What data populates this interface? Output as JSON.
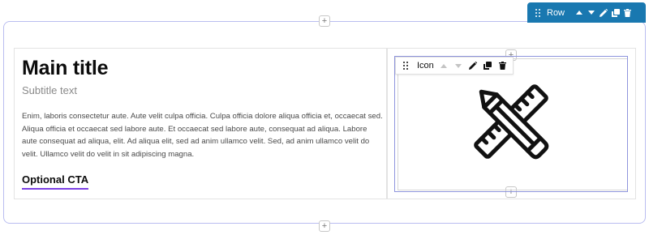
{
  "row_toolbar": {
    "label": "Row",
    "drag_icon": "drag-handle-icon",
    "move_up_icon": "caret-up-icon",
    "move_down_icon": "caret-down-icon",
    "edit_icon": "pencil-icon",
    "duplicate_icon": "duplicate-icon",
    "delete_icon": "trash-icon",
    "background": "#1978b0"
  },
  "add_buttons": {
    "top_row": "+",
    "column": "+",
    "column_bottom": "+",
    "bottom_row": "+"
  },
  "content": {
    "title": "Main title",
    "subtitle": "Subtitle text",
    "body": "Enim, laboris consectetur aute. Aute velit culpa officia. Culpa officia dolore aliqua officia et, occaecat sed. Aliqua officia et occaecat sed labore aute. Et occaecat sed labore aute, consequat ad aliqua. Labore aute consequat ad aliqua, elit. Ad aliqua elit, sed ad anim ullamco velit. Sed, ad anim ullamco velit do velit. Ullamco velit do velit in sit adipiscing magna.",
    "cta": "Optional CTA",
    "cta_underline_color": "#7b3fe4"
  },
  "icon_toolbar": {
    "label": "Icon",
    "drag_icon": "drag-handle-icon",
    "move_up_icon": "caret-up-icon",
    "move_down_icon": "caret-down-icon",
    "edit_icon": "pencil-icon",
    "duplicate_icon": "duplicate-icon",
    "delete_icon": "trash-icon"
  },
  "icon_module": {
    "icon": "pencil-ruler-icon",
    "outline_color": "#8f95dd"
  }
}
